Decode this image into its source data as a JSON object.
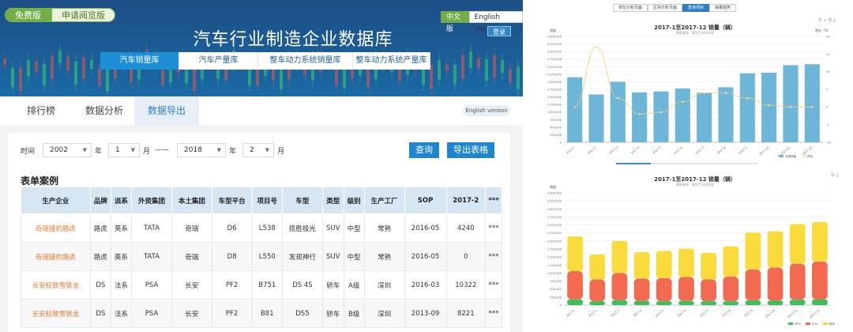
{
  "header": {
    "free_label": "免费版",
    "trial_label": "申请阅览版",
    "lang_zh": "中文版",
    "lang_en": "English version",
    "login": "登录",
    "site_title": "汽车行业制造企业数据库",
    "tabs": [
      "汽车销量库",
      "汽车产量库",
      "整车动力系统销量库",
      "整车动力系统产量库"
    ]
  },
  "subnav": {
    "items": [
      "排行榜",
      "数据分析",
      "数据导出"
    ],
    "english_pill": "English version"
  },
  "filter": {
    "time_label": "时间",
    "from_year": "2002",
    "year_unit": "年",
    "from_month": "1",
    "month_unit": "月",
    "dash": "——",
    "to_year": "2018",
    "to_month": "2",
    "query_button": "查询",
    "export_button": "导出表格"
  },
  "table": {
    "title": "表单案例",
    "columns": [
      "生产企业",
      "品牌",
      "派系",
      "外资集团",
      "本土集团",
      "车型平台",
      "项目号",
      "车型",
      "类型",
      "级别",
      "生产工厂",
      "SOP",
      "2017-2",
      "***"
    ],
    "rows": [
      [
        "奇瑞捷豹路虎",
        "路虎",
        "英系",
        "TATA",
        "奇瑞",
        "D6",
        "L538",
        "揽胜极光",
        "SUV",
        "中型",
        "常熟",
        "2016-05",
        "4240",
        "***"
      ],
      [
        "奇瑞捷豹路虎",
        "路虎",
        "英系",
        "TATA",
        "奇瑞",
        "D8",
        "L550",
        "发现神行",
        "SUV",
        "中型",
        "常熟",
        "2016-05",
        "0",
        "***"
      ],
      [
        "长安标致雪铁龙",
        "DS",
        "法系",
        "PSA",
        "长安",
        "PF2",
        "B751",
        "DS 4S",
        "轿车",
        "A级",
        "深圳",
        "2016-03",
        "10322",
        "***"
      ],
      [
        "长安标致雪铁龙",
        "DS",
        "法系",
        "PSA",
        "长安",
        "PF2",
        "B81",
        "DS5",
        "轿车",
        "B级",
        "深圳",
        "2013-09",
        "8221",
        "***"
      ]
    ]
  },
  "chart_tabs": [
    "单位分析页面",
    "区块分析页面",
    "查询项目",
    "销量趋势"
  ],
  "colors": {
    "banner": "#1b5d96",
    "accent_blue": "#1e86cf",
    "free_green": "#74ad45",
    "bar_blue": "#6db6d8",
    "line_yellow": "#f3cd6a",
    "stack_green": "#3cbf5a",
    "stack_red": "#f26a4f",
    "stack_yellow": "#f9dc3b"
  },
  "chart_data": [
    {
      "type": "bar",
      "title": "2017-1至2017-12 销量（辆）",
      "subtitle": "数据来源：盖世汽车研究院",
      "ylabel": "销量",
      "y2label": "增长（%）",
      "categories": [
        "2017-1",
        "2017-2",
        "2017-3",
        "2017-4",
        "2017-5",
        "2017-6",
        "2017-7",
        "2017-8",
        "2017-9",
        "2017-10",
        "2017-11",
        "2017-12"
      ],
      "ylim": [
        0,
        3500000
      ],
      "yticks": [
        "0",
        "250,000",
        "500,000",
        "750,000",
        "1,000,000",
        "1,250,000",
        "1,500,000",
        "1,750,000",
        "2,000,000",
        "2,250,000",
        "2,500,000",
        "2,750,000",
        "3,000,000",
        "3,250,000",
        "3,500,000"
      ],
      "y2lim": [
        -10,
        20
      ],
      "y2ticks": [
        "-10",
        "-5",
        "0",
        "5",
        "10",
        "15",
        "20"
      ],
      "series": [
        {
          "name": "当前销量",
          "kind": "bar",
          "values": [
            2150000,
            1580000,
            2000000,
            1650000,
            1680000,
            1780000,
            1640000,
            1820000,
            2280000,
            2300000,
            2550000,
            2580000
          ]
        },
        {
          "name": "同比",
          "kind": "line",
          "axis": "right",
          "values": [
            0,
            17,
            2.5,
            -2,
            -1.5,
            1.5,
            4,
            4,
            2.5,
            0.5,
            0,
            0
          ]
        }
      ],
      "legend": "bottom-right"
    },
    {
      "type": "bar",
      "stacked": true,
      "title": "2017-1至2017-12 销量（辆）",
      "subtitle": "数据来源：盖世汽车研究院",
      "ylabel": "销量",
      "categories": [
        "2017-1",
        "2017-2",
        "2017-3",
        "2017-4",
        "2017-5",
        "2017-6",
        "2017-7",
        "2017-8",
        "2017-9",
        "2017-10",
        "2017-11",
        "2017-12"
      ],
      "ylim": [
        0,
        3500000
      ],
      "yticks": [
        "0",
        "250,000",
        "500,000",
        "750,000",
        "1,000,000",
        "1,250,000",
        "1,500,000",
        "1,750,000",
        "2,000,000",
        "2,250,000",
        "2,500,000",
        "2,750,000",
        "3,000,000",
        "3,250,000",
        "3,500,000"
      ],
      "series": [
        {
          "name": "MPV",
          "values": [
            180000,
            120000,
            150000,
            130000,
            120000,
            130000,
            120000,
            120000,
            150000,
            140000,
            170000,
            180000
          ]
        },
        {
          "name": "SUV",
          "values": [
            880000,
            680000,
            850000,
            700000,
            720000,
            750000,
            680000,
            770000,
            960000,
            1030000,
            1120000,
            1180000
          ]
        },
        {
          "name": "轿车",
          "values": [
            1080000,
            780000,
            1000000,
            820000,
            850000,
            880000,
            830000,
            940000,
            1150000,
            1130000,
            1240000,
            1230000
          ]
        }
      ],
      "legend": "bottom-right"
    }
  ]
}
